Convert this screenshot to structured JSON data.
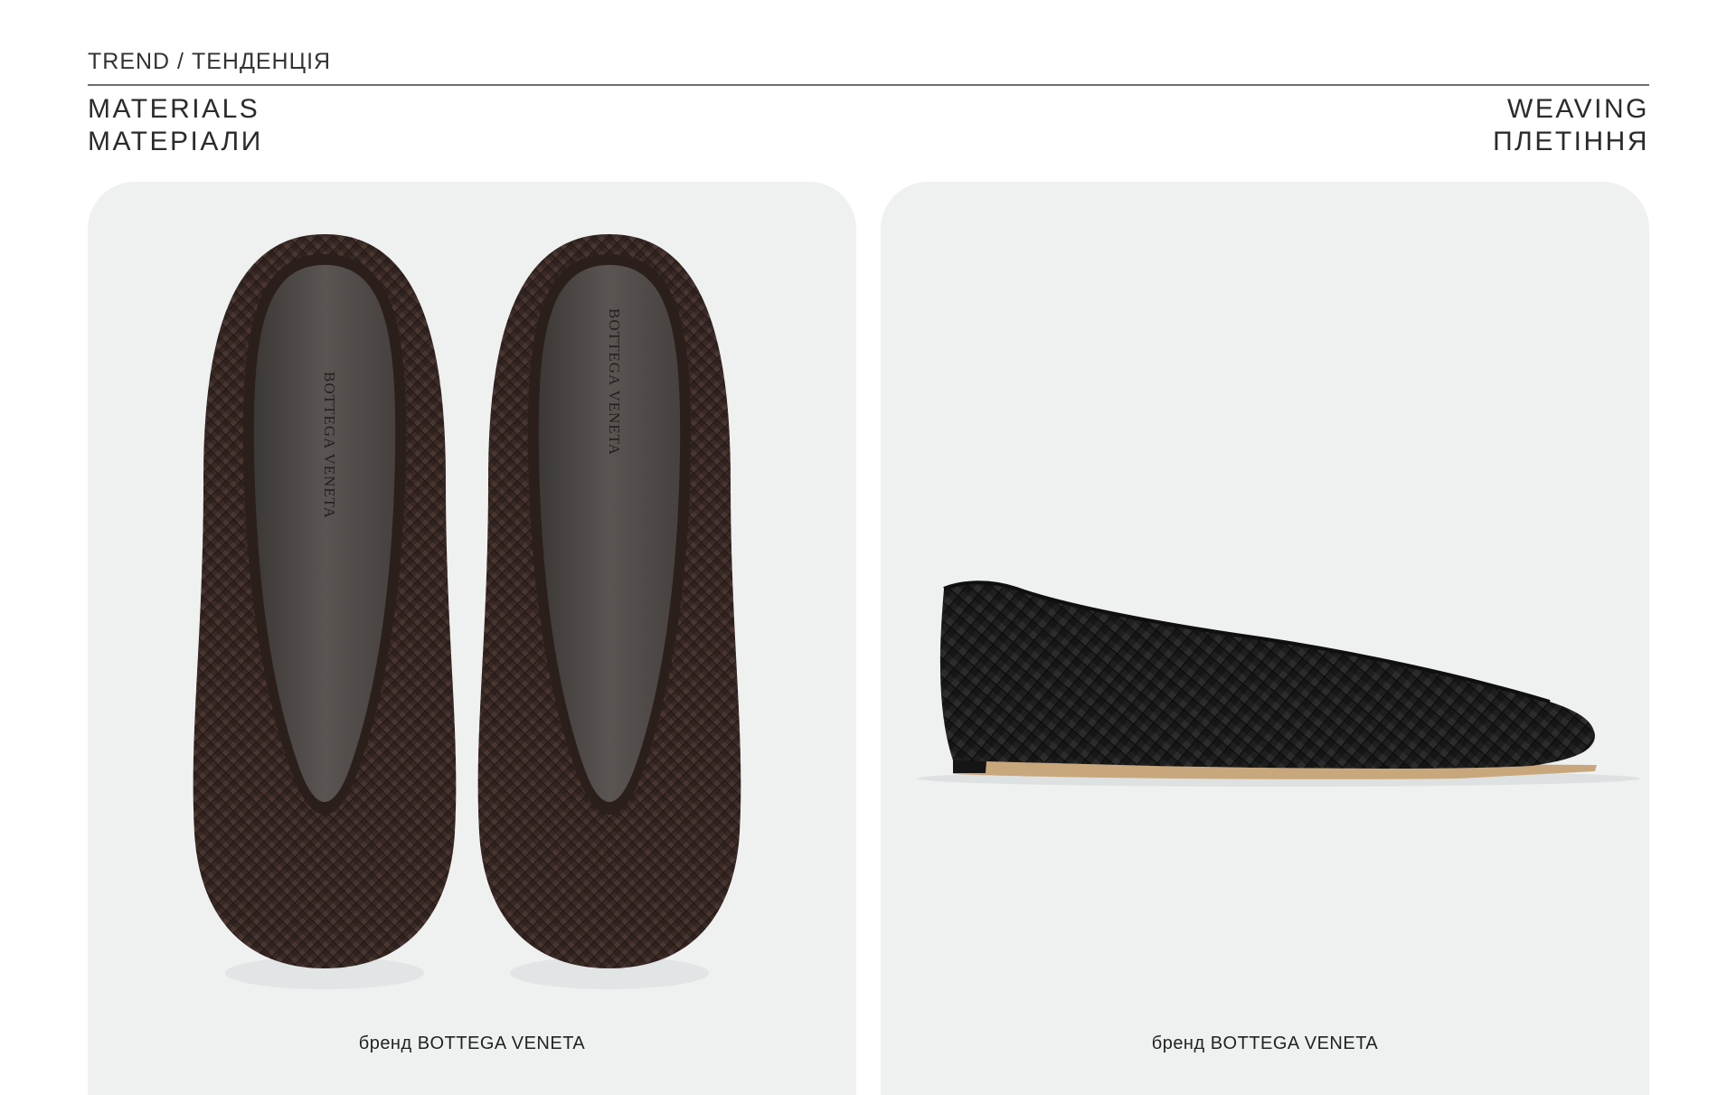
{
  "header": {
    "breadcrumb": "TREND / ТЕНДЕНЦІЯ",
    "category_en": "MATERIALS",
    "category_uk": "МАТЕРІАЛИ",
    "topic_en": "WEAVING",
    "topic_uk": "ПЛЕТІННЯ"
  },
  "cards": [
    {
      "image": "woven-ballet-flats-pair-top-view",
      "insole_text": "BOTTEGA VENETA",
      "caption": "бренд BOTTEGA VENETA"
    },
    {
      "image": "woven-flat-side-view",
      "caption": "бренд BOTTEGA VENETA"
    }
  ],
  "colors": {
    "card_background": "#eff1f1",
    "rule": "#6e6e6e",
    "shoe_brown": "#3a2a26",
    "shoe_black": "#1f1f1f",
    "insole": "#4e4a47",
    "sole_tan": "#c9a77c"
  }
}
